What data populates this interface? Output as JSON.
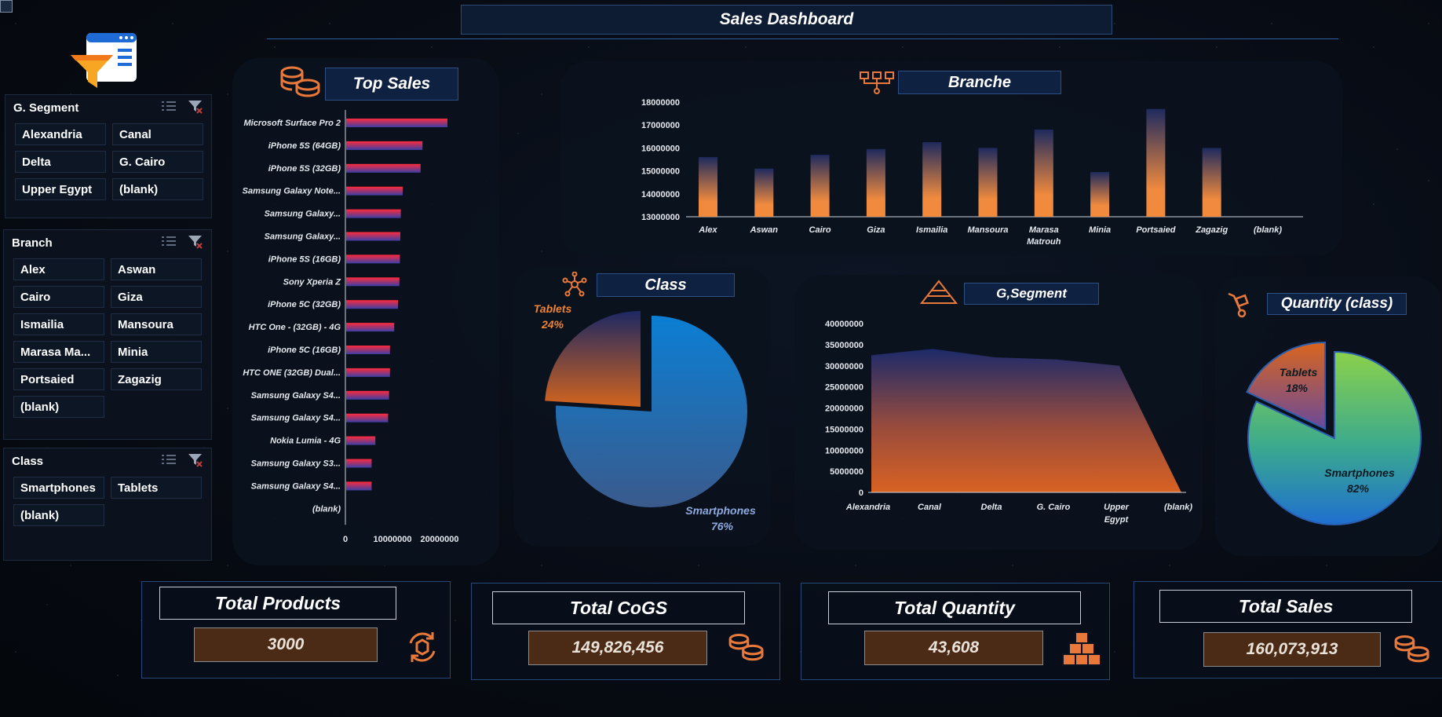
{
  "dashboard": {
    "title": "Sales Dashboard"
  },
  "slicers": {
    "segment": {
      "title": "G. Segment",
      "items": [
        "Alexandria",
        "Canal",
        "Delta",
        "G. Cairo",
        "Upper Egypt",
        "(blank)"
      ]
    },
    "branch": {
      "title": "Branch",
      "items": [
        "Alex",
        "Aswan",
        "Cairo",
        "Giza",
        "Ismailia",
        "Mansoura",
        "Marasa Ma...",
        "Minia",
        "Portsaied",
        "Zagazig",
        "(blank)"
      ]
    },
    "class": {
      "title": "Class",
      "items": [
        "Smartphones",
        "Tablets",
        "(blank)"
      ]
    }
  },
  "top_sales": {
    "title": "Top Sales",
    "chart_data": {
      "type": "bar",
      "orientation": "horizontal",
      "categories": [
        "Microsoft Surface Pro 2",
        "iPhone 5S (64GB)",
        "iPhone 5S (32GB)",
        "Samsung Galaxy Note...",
        "Samsung Galaxy...",
        "Samsung Galaxy...",
        "iPhone 5S (16GB)",
        "Sony Xperia Z",
        "iPhone 5C (32GB)",
        "HTC One - (32GB) - 4G",
        "iPhone 5C (16GB)",
        "HTC ONE (32GB) Dual...",
        "Samsung Galaxy S4...",
        "Samsung Galaxy S4...",
        "Nokia Lumia  - 4G",
        "Samsung Galaxy S3...",
        "Samsung Galaxy S4...",
        "(blank)"
      ],
      "values": [
        21500000,
        16200000,
        15800000,
        12000000,
        11600000,
        11500000,
        11400000,
        11300000,
        11000000,
        10200000,
        9300000,
        9300000,
        9100000,
        8900000,
        6200000,
        5400000,
        5400000,
        0
      ],
      "xlim": [
        0,
        25000000
      ],
      "xticks": [
        "0",
        "10000000",
        "20000000"
      ]
    }
  },
  "branch_chart": {
    "title": "Branche",
    "chart_data": {
      "type": "bar",
      "categories": [
        "Alex",
        "Aswan",
        "Cairo",
        "Giza",
        "Ismailia",
        "Mansoura",
        "Marasa Matrouh",
        "Minia",
        "Portsaied",
        "Zagazig",
        "(blank)"
      ],
      "category_lines": [
        [
          "Alex"
        ],
        [
          "Aswan"
        ],
        [
          "Cairo"
        ],
        [
          "Giza"
        ],
        [
          "Ismailia"
        ],
        [
          "Mansoura"
        ],
        [
          "Marasa",
          "Matrouh"
        ],
        [
          "Minia"
        ],
        [
          "Portsaied"
        ],
        [
          "Zagazig"
        ],
        [
          "(blank)"
        ]
      ],
      "values": [
        15600000,
        15100000,
        15700000,
        15950000,
        16250000,
        16000000,
        16800000,
        14950000,
        17700000,
        16000000,
        0
      ],
      "ylim": [
        13000000,
        18000000
      ],
      "yticks": [
        "18000000",
        "17000000",
        "16000000",
        "15000000",
        "14000000",
        "13000000"
      ]
    }
  },
  "class_chart": {
    "title": "Class",
    "chart_data": {
      "type": "pie",
      "slices": [
        {
          "name": "Smartphones",
          "value": 76,
          "label": "76%"
        },
        {
          "name": "Tablets",
          "value": 24,
          "label": "24%"
        }
      ]
    }
  },
  "segment_chart": {
    "title": "G,Segment",
    "chart_data": {
      "type": "area",
      "categories": [
        "Alexandria",
        "Canal",
        "Delta",
        "G. Cairo",
        "Upper Egypt",
        "(blank)"
      ],
      "category_lines": [
        [
          "Alexandria"
        ],
        [
          "Canal"
        ],
        [
          "Delta"
        ],
        [
          "G. Cairo"
        ],
        [
          "Upper",
          "Egypt"
        ],
        [
          "(blank)"
        ]
      ],
      "values": [
        32500000,
        34000000,
        32000000,
        31500000,
        30000000,
        0
      ],
      "ylim": [
        0,
        40000000
      ],
      "yticks": [
        "40000000",
        "35000000",
        "30000000",
        "25000000",
        "20000000",
        "15000000",
        "10000000",
        "5000000",
        "0"
      ]
    }
  },
  "quantity_chart": {
    "title": "Quantity (class)",
    "chart_data": {
      "type": "pie",
      "slices": [
        {
          "name": "Smartphones",
          "value": 82,
          "label": "82%"
        },
        {
          "name": "Tablets",
          "value": 18,
          "label": "18%"
        }
      ]
    }
  },
  "kpis": {
    "products": {
      "title": "Total Products",
      "value": "3000"
    },
    "cogs": {
      "title": "Total CoGS",
      "value": "149,826,456"
    },
    "quantity": {
      "title": "Total Quantity",
      "value": "43,608"
    },
    "sales": {
      "title": "Total Sales",
      "value": "160,073,913"
    }
  },
  "colors": {
    "accent_orange": "#e8793a",
    "bar_red": "#e0203c",
    "bar_blue": "#3a4aa8",
    "navy": "#1e2a55"
  }
}
